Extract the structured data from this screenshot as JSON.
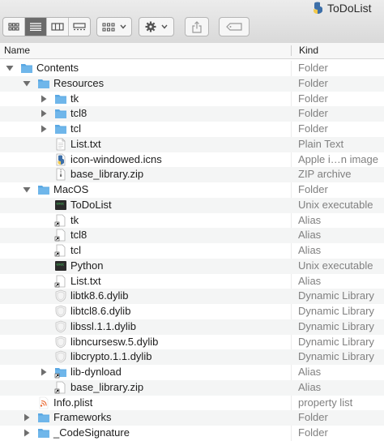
{
  "window": {
    "title": "ToDoList"
  },
  "toolbar": {
    "view_buttons": [
      "icon-view-icon",
      "list-view-icon",
      "column-view-icon",
      "gallery-view-icon"
    ],
    "group_icon": "group-by-icon",
    "action_icon": "gear-icon",
    "share_icon": "share-icon",
    "tag_icon": "tag-icon"
  },
  "columns": {
    "name": "Name",
    "kind": "Kind"
  },
  "colors": {
    "folder": "#6fb6ea",
    "selected_segment": "#6b6b6b",
    "row_alt": "#f4f5f5"
  },
  "rows": [
    {
      "name": "Contents",
      "kind": "Folder",
      "icon": "folder-icon",
      "disclosure": "open"
    },
    {
      "name": "Resources",
      "kind": "Folder",
      "icon": "folder-icon",
      "disclosure": "open"
    },
    {
      "name": "tk",
      "kind": "Folder",
      "icon": "folder-icon",
      "disclosure": "closed"
    },
    {
      "name": "tcl8",
      "kind": "Folder",
      "icon": "folder-icon",
      "disclosure": "closed"
    },
    {
      "name": "tcl",
      "kind": "Folder",
      "icon": "folder-icon",
      "disclosure": "closed"
    },
    {
      "name": "List.txt",
      "kind": "Plain Text",
      "icon": "text-file-icon",
      "disclosure": "none"
    },
    {
      "name": "icon-windowed.icns",
      "kind": "Apple i…n image",
      "icon": "icns-file-icon",
      "disclosure": "none"
    },
    {
      "name": "base_library.zip",
      "kind": "ZIP archive",
      "icon": "zip-file-icon",
      "disclosure": "none"
    },
    {
      "name": "MacOS",
      "kind": "Folder",
      "icon": "folder-icon",
      "disclosure": "open"
    },
    {
      "name": "ToDoList",
      "kind": "Unix executable",
      "icon": "executable-icon",
      "disclosure": "none"
    },
    {
      "name": "tk",
      "kind": "Alias",
      "icon": "alias-icon",
      "disclosure": "none"
    },
    {
      "name": "tcl8",
      "kind": "Alias",
      "icon": "alias-icon",
      "disclosure": "none"
    },
    {
      "name": "tcl",
      "kind": "Alias",
      "icon": "alias-icon",
      "disclosure": "none"
    },
    {
      "name": "Python",
      "kind": "Unix executable",
      "icon": "executable-icon",
      "disclosure": "none"
    },
    {
      "name": "List.txt",
      "kind": "Alias",
      "icon": "alias-icon",
      "disclosure": "none"
    },
    {
      "name": "libtk8.6.dylib",
      "kind": "Dynamic Library",
      "icon": "dylib-icon",
      "disclosure": "none"
    },
    {
      "name": "libtcl8.6.dylib",
      "kind": "Dynamic Library",
      "icon": "dylib-icon",
      "disclosure": "none"
    },
    {
      "name": "libssl.1.1.dylib",
      "kind": "Dynamic Library",
      "icon": "dylib-icon",
      "disclosure": "none"
    },
    {
      "name": "libncursesw.5.dylib",
      "kind": "Dynamic Library",
      "icon": "dylib-icon",
      "disclosure": "none"
    },
    {
      "name": "libcrypto.1.1.dylib",
      "kind": "Dynamic Library",
      "icon": "dylib-icon",
      "disclosure": "none"
    },
    {
      "name": "lib-dynload",
      "kind": "Alias",
      "icon": "folder-alias-icon",
      "disclosure": "closed"
    },
    {
      "name": "base_library.zip",
      "kind": "Alias",
      "icon": "alias-icon",
      "disclosure": "none"
    },
    {
      "name": "Info.plist",
      "kind": "property list",
      "icon": "plist-icon",
      "disclosure": "none"
    },
    {
      "name": "Frameworks",
      "kind": "Folder",
      "icon": "folder-icon",
      "disclosure": "closed"
    },
    {
      "name": "_CodeSignature",
      "kind": "Folder",
      "icon": "folder-icon",
      "disclosure": "closed"
    }
  ]
}
